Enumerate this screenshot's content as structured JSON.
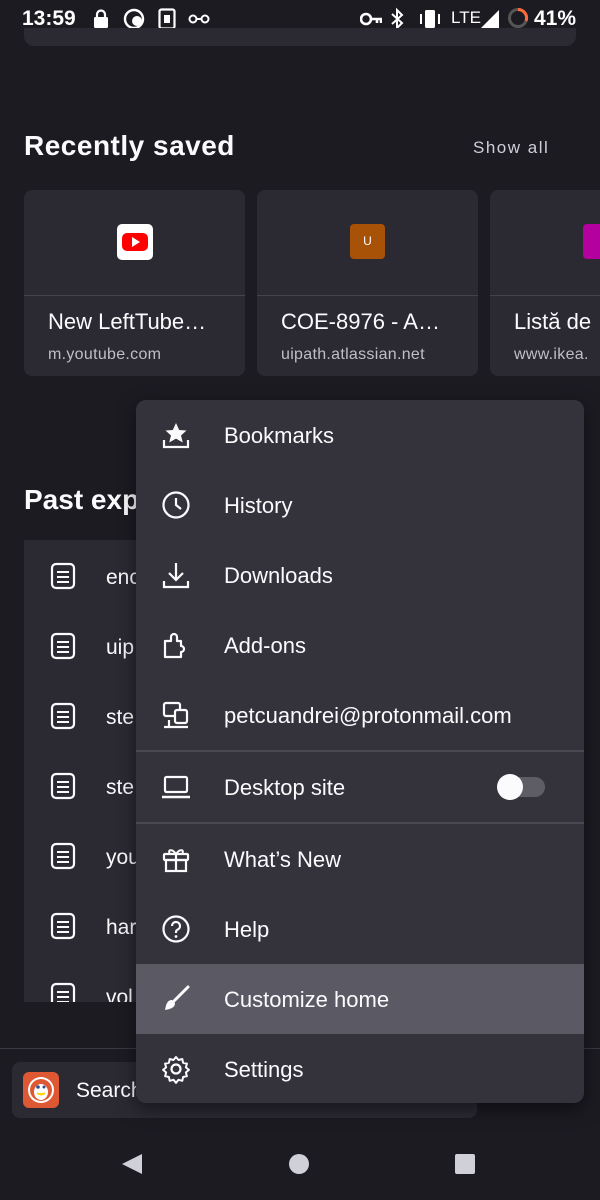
{
  "status_bar": {
    "time": "13:59",
    "network": "LTE",
    "battery": "41%"
  },
  "recently_saved": {
    "title": "Recently saved",
    "show_all": "Show all",
    "cards": [
      {
        "title": "New LeftTube…",
        "url": "m.youtube.com",
        "icon": "youtube-icon",
        "icon_color": "#ff0000"
      },
      {
        "title": "COE-8976 - A…",
        "url": "uipath.atlassian.net",
        "icon": "letter-u",
        "icon_letter": "U",
        "icon_color": "#a85208"
      },
      {
        "title": "Listă de",
        "url": "www.ikea.",
        "icon": "pink-square",
        "icon_color": "#b3009e"
      }
    ]
  },
  "past_explorations": {
    "title": "Past exp",
    "items": [
      "enc",
      "uip",
      "ste",
      "ste",
      "you",
      "har",
      "vol"
    ]
  },
  "search": {
    "label": "Search"
  },
  "menu": {
    "items": [
      {
        "label": "Bookmarks",
        "icon": "star-tray-icon"
      },
      {
        "label": "History",
        "icon": "clock-icon"
      },
      {
        "label": "Downloads",
        "icon": "download-icon"
      },
      {
        "label": "Add-ons",
        "icon": "puzzle-icon"
      },
      {
        "label": "petcuandrei@protonmail.com",
        "icon": "account-sync-icon"
      },
      {
        "label": "Desktop site",
        "icon": "laptop-icon",
        "toggle": false
      },
      {
        "label": "What’s New",
        "icon": "gift-icon"
      },
      {
        "label": "Help",
        "icon": "help-icon"
      },
      {
        "label": "Customize home",
        "icon": "brush-icon",
        "highlighted": true
      },
      {
        "label": "Settings",
        "icon": "gear-icon"
      }
    ]
  },
  "colors": {
    "background": "#1c1b22",
    "card": "#2b2a33",
    "menu": "#34333c",
    "highlight": "#5b5a64",
    "duckduckgo": "#de5833"
  }
}
